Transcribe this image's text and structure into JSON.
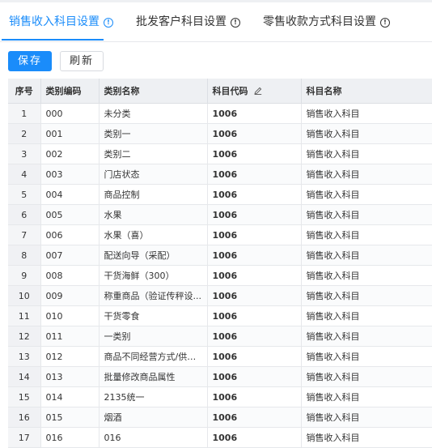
{
  "tabs": [
    {
      "label": "销售收入科目设置",
      "active": true
    },
    {
      "label": "批发客户科目设置",
      "active": false
    },
    {
      "label": "零售收款方式科目设置",
      "active": false
    }
  ],
  "toolbar": {
    "save_label": "保存",
    "refresh_label": "刷新"
  },
  "table": {
    "headers": {
      "index": "序号",
      "category_code": "类别编码",
      "category_name": "类别名称",
      "subject_code": "科目代码",
      "subject_name": "科目名称"
    },
    "rows": [
      {
        "index": "1",
        "category_code": "000",
        "category_name": "未分类",
        "subject_code": "1006",
        "subject_name": "销售收入科目"
      },
      {
        "index": "2",
        "category_code": "001",
        "category_name": "类别一",
        "subject_code": "1006",
        "subject_name": "销售收入科目"
      },
      {
        "index": "3",
        "category_code": "002",
        "category_name": "类别二",
        "subject_code": "1006",
        "subject_name": "销售收入科目"
      },
      {
        "index": "4",
        "category_code": "003",
        "category_name": "门店状态",
        "subject_code": "1006",
        "subject_name": "销售收入科目"
      },
      {
        "index": "5",
        "category_code": "004",
        "category_name": "商品控制",
        "subject_code": "1006",
        "subject_name": "销售收入科目"
      },
      {
        "index": "6",
        "category_code": "005",
        "category_name": "水果",
        "subject_code": "1006",
        "subject_name": "销售收入科目"
      },
      {
        "index": "7",
        "category_code": "006",
        "category_name": "水果（喜）",
        "subject_code": "1006",
        "subject_name": "销售收入科目"
      },
      {
        "index": "8",
        "category_code": "007",
        "category_name": "配送向导（采配）",
        "subject_code": "1006",
        "subject_name": "销售收入科目"
      },
      {
        "index": "9",
        "category_code": "008",
        "category_name": "干货海鲜（300）",
        "subject_code": "1006",
        "subject_name": "销售收入科目"
      },
      {
        "index": "10",
        "category_code": "009",
        "category_name": "称重商品（验证传秤设...",
        "subject_code": "1006",
        "subject_name": "销售收入科目"
      },
      {
        "index": "11",
        "category_code": "010",
        "category_name": "干货零食",
        "subject_code": "1006",
        "subject_name": "销售收入科目"
      },
      {
        "index": "12",
        "category_code": "011",
        "category_name": "一类别",
        "subject_code": "1006",
        "subject_name": "销售收入科目"
      },
      {
        "index": "13",
        "category_code": "012",
        "category_name": "商品不同经营方式/供应商",
        "subject_code": "1006",
        "subject_name": "销售收入科目"
      },
      {
        "index": "14",
        "category_code": "013",
        "category_name": "批量修改商品属性",
        "subject_code": "1006",
        "subject_name": "销售收入科目"
      },
      {
        "index": "15",
        "category_code": "014",
        "category_name": "2135统一",
        "subject_code": "1006",
        "subject_name": "销售收入科目"
      },
      {
        "index": "16",
        "category_code": "015",
        "category_name": "烟酒",
        "subject_code": "1006",
        "subject_name": "销售收入科目"
      },
      {
        "index": "17",
        "category_code": "016",
        "category_name": "016",
        "subject_code": "1006",
        "subject_name": "销售收入科目"
      }
    ]
  },
  "icons": {
    "tab_info": "info-circle-icon",
    "edit": "pencil-icon"
  },
  "colors": {
    "accent": "#1a8cfa",
    "header_bg": "#eef0f3"
  }
}
